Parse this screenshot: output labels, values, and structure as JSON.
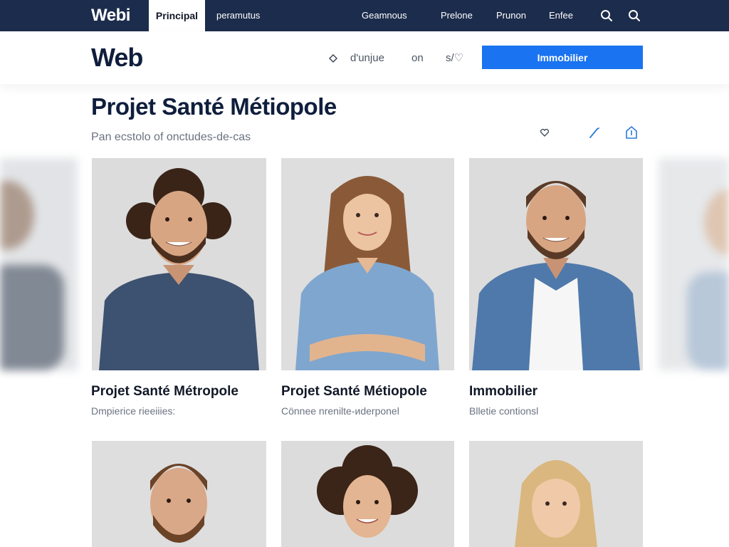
{
  "topnav": {
    "logo": "Webi",
    "active_tab": "Principal",
    "links": [
      "peramutus",
      "Geamnous",
      "Prelone",
      "Prunon",
      "Enfee"
    ],
    "icons": [
      "search-icon",
      "search-icon"
    ]
  },
  "header": {
    "brand": "Web",
    "links": [
      "d'unjue",
      "on",
      "s/♡"
    ],
    "cta_label": "Immobilier"
  },
  "page": {
    "title": "Projet Santé Métiopole",
    "subtitle": "Pan ecstolo of onctudes-de-cas",
    "actions": [
      "heart-icon",
      "edit-icon",
      "share-icon"
    ]
  },
  "cards": [
    {
      "name": "Projet Santé Métropole",
      "role": "Dmpierice rieeiiies:"
    },
    {
      "name": "Projet Santé Métiopole",
      "role": "Cönnee nrenilte-иderponel"
    },
    {
      "name": "Immobilier",
      "role": "Blletie contionsl"
    }
  ],
  "colors": {
    "nav_bg": "#1c2c4c",
    "brand_navy": "#0f1e3c",
    "accent_blue": "#1a73f0",
    "muted_text": "#6b7280",
    "photo_bg": "#e5e7ea"
  }
}
